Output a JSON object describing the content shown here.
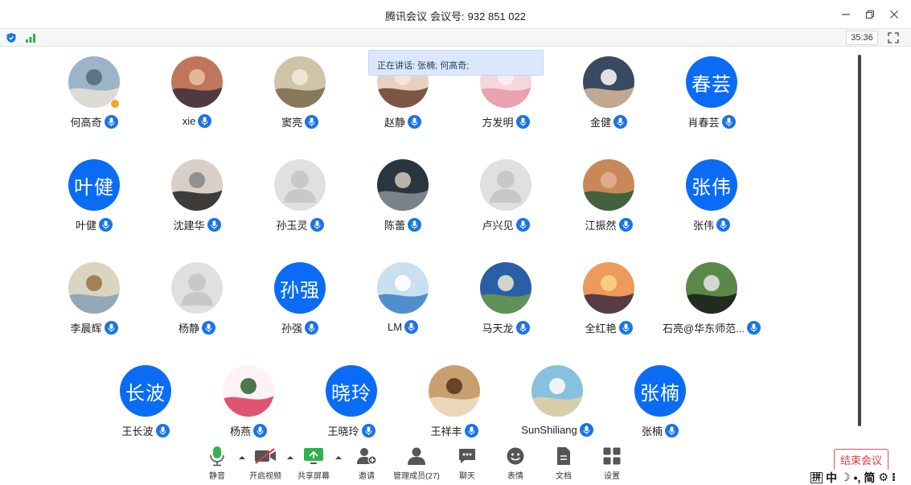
{
  "window": {
    "app_title": "腾讯会议",
    "meeting_label": "会议号:",
    "meeting_id": "932 851 022"
  },
  "status": {
    "timer": "35:36"
  },
  "speaking": {
    "text": "正在讲话: 张楠; 何高奇;"
  },
  "participants": [
    {
      "name": "何高奇",
      "avatar": "photo",
      "host": true
    },
    {
      "name": "xie",
      "avatar": "photo"
    },
    {
      "name": "窦亮",
      "avatar": "photo"
    },
    {
      "name": "赵静",
      "avatar": "photo"
    },
    {
      "name": "方发明",
      "avatar": "photo"
    },
    {
      "name": "金健",
      "avatar": "photo"
    },
    {
      "name": "肖春芸",
      "avatar": "text",
      "initials": "春芸"
    },
    {
      "name": "叶健",
      "avatar": "text",
      "initials": "叶健"
    },
    {
      "name": "沈建华",
      "avatar": "photo"
    },
    {
      "name": "孙玉灵",
      "avatar": "default"
    },
    {
      "name": "陈蕾",
      "avatar": "photo"
    },
    {
      "name": "卢兴见",
      "avatar": "default"
    },
    {
      "name": "江振然",
      "avatar": "photo"
    },
    {
      "name": "张伟",
      "avatar": "text",
      "initials": "张伟"
    },
    {
      "name": "李晨辉",
      "avatar": "photo"
    },
    {
      "name": "杨静",
      "avatar": "default"
    },
    {
      "name": "孙强",
      "avatar": "text",
      "initials": "孙强"
    },
    {
      "name": "LM",
      "avatar": "photo"
    },
    {
      "name": "马天龙",
      "avatar": "photo"
    },
    {
      "name": "全红艳",
      "avatar": "photo"
    },
    {
      "name": "石亮@华东师范...",
      "avatar": "photo"
    },
    {
      "name": "王长波",
      "avatar": "text",
      "initials": "长波"
    },
    {
      "name": "杨燕",
      "avatar": "photo"
    },
    {
      "name": "王晓玲",
      "avatar": "text",
      "initials": "晓玲"
    },
    {
      "name": "王祥丰",
      "avatar": "photo"
    },
    {
      "name": "SunShiliang",
      "avatar": "photo"
    },
    {
      "name": "张楠",
      "avatar": "text",
      "initials": "张楠"
    }
  ],
  "toolbar": {
    "mute": "静音",
    "video": "开启视频",
    "share": "共享屏幕",
    "invite": "邀请",
    "members": "管理成员(27)",
    "chat": "聊天",
    "reactions": "表情",
    "docs": "文档",
    "settings": "设置",
    "end": "结束会议"
  },
  "ime": {
    "grid": "拼",
    "lang": "中",
    "moon": "☽",
    "punct": "•,",
    "simp": "简",
    "gear": "⚙",
    "more": "⁝"
  },
  "colors": {
    "accent": "#0a6cf5",
    "mic": "#1a73e8",
    "end": "#e23b3b",
    "speaking_bg": "#dbe8fb"
  }
}
